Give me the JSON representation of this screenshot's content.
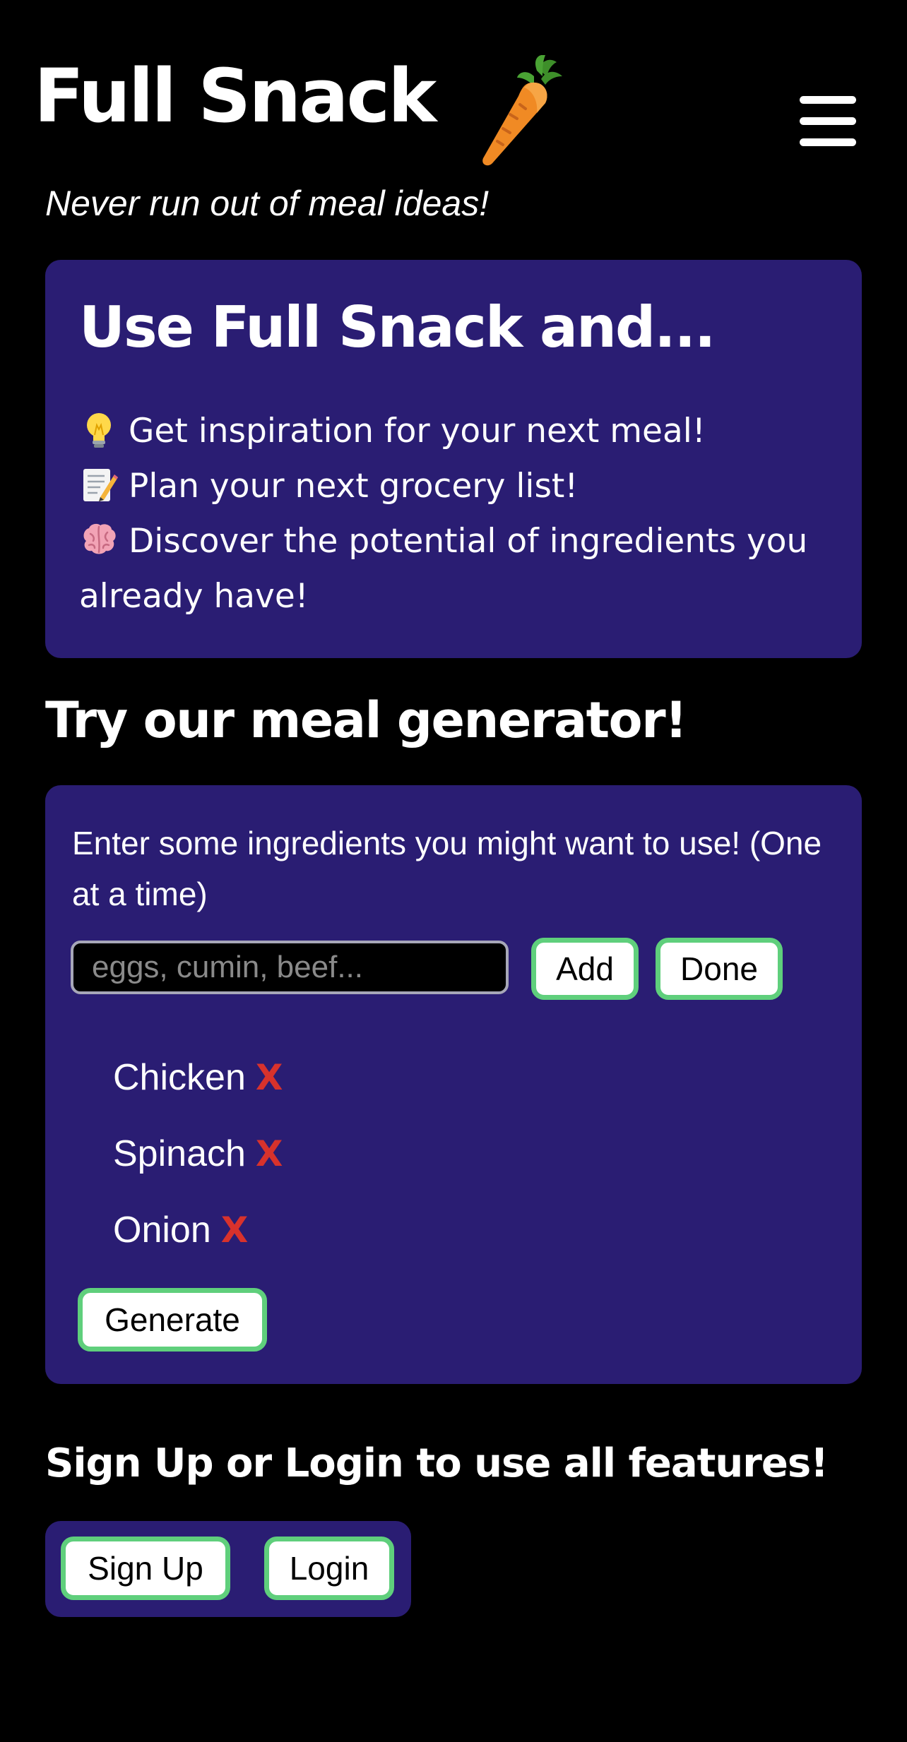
{
  "header": {
    "title": "Full Snack",
    "logo_icon": "carrot-icon",
    "menu_icon": "hamburger-menu-icon",
    "tagline": "Never run out of meal ideas!"
  },
  "intro": {
    "heading": "Use Full Snack and...",
    "items": [
      {
        "icon": "lightbulb-icon",
        "text": "Get inspiration for your next meal!"
      },
      {
        "icon": "memo-icon",
        "text": "Plan your next grocery list!"
      },
      {
        "icon": "brain-icon",
        "text": "Discover the potential of ingredients you already have!"
      }
    ]
  },
  "generator": {
    "heading": "Try our meal generator!",
    "instructions": "Enter some ingredients you might want to use! (One at a time)",
    "input_placeholder": "eggs, cumin, beef...",
    "input_value": "",
    "add_label": "Add",
    "done_label": "Done",
    "ingredients": [
      "Chicken",
      "Spinach",
      "Onion"
    ],
    "remove_label": "X",
    "generate_label": "Generate"
  },
  "auth": {
    "heading": "Sign Up or Login to use all features!",
    "signup_label": "Sign Up",
    "login_label": "Login"
  },
  "colors": {
    "background": "#000000",
    "panel": "#2a1d73",
    "button_border": "#5fcf7c",
    "remove_x": "#d8322c",
    "text": "#ffffff"
  }
}
